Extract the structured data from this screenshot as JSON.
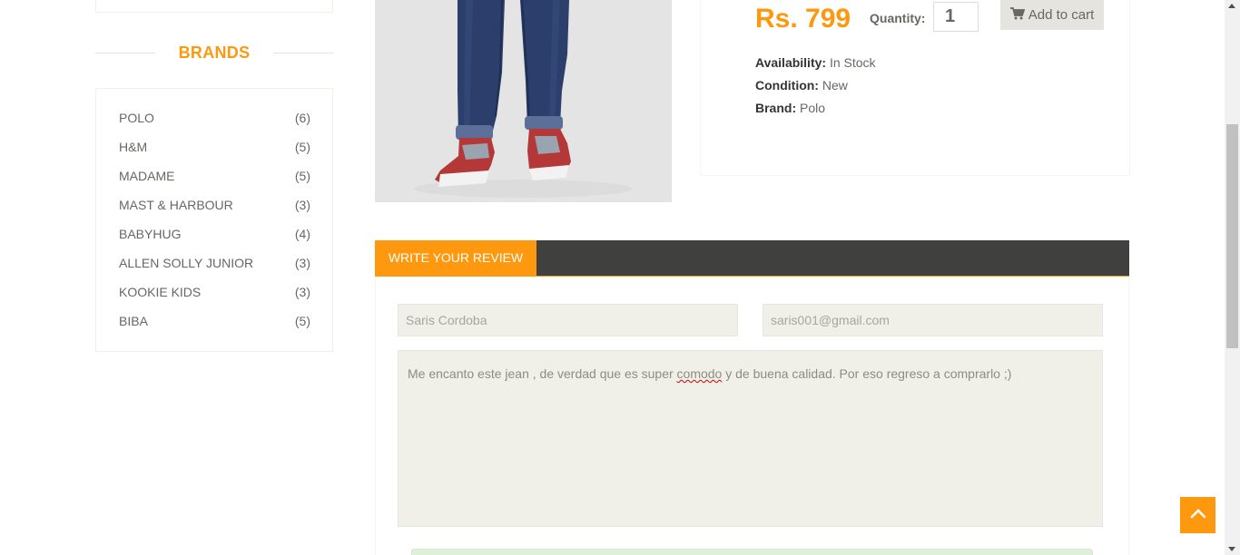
{
  "sidebar": {
    "brands_title": "BRANDS",
    "brands": [
      {
        "name": "POLO",
        "count": "(6)"
      },
      {
        "name": "H&M",
        "count": "(5)"
      },
      {
        "name": "MADAME",
        "count": "(5)"
      },
      {
        "name": "MAST & HARBOUR",
        "count": "(3)"
      },
      {
        "name": "BABYHUG",
        "count": "(4)"
      },
      {
        "name": "ALLEN SOLLY JUNIOR",
        "count": "(3)"
      },
      {
        "name": "KOOKIE KIDS",
        "count": "(3)"
      },
      {
        "name": "BIBA",
        "count": "(5)"
      }
    ]
  },
  "product": {
    "price": "Rs. 799",
    "quantity_label": "Quantity:",
    "quantity_value": "1",
    "add_to_cart_label": "Add to cart",
    "availability_label": "Availability:",
    "availability_value": "In Stock",
    "condition_label": "Condition:",
    "condition_value": "New",
    "brand_label": "Brand:",
    "brand_value": "Polo"
  },
  "review": {
    "tab_label": "WRITE YOUR REVIEW",
    "name_value": "Saris Cordoba",
    "email_value": "saris001@gmail.com",
    "text_before": "Me encanto este jean , de verdad que es super ",
    "text_misspelled": "comodo",
    "text_after": " y de buena calidad. Por eso regreso a comprarlo ;)"
  },
  "colors": {
    "accent": "#fe980f",
    "dark_bar": "#40403e",
    "field_bg": "#f0f0e9",
    "text": "#696763"
  },
  "icons": {
    "cart": "shopping-cart-icon",
    "scroll_top": "chevron-up-icon"
  }
}
